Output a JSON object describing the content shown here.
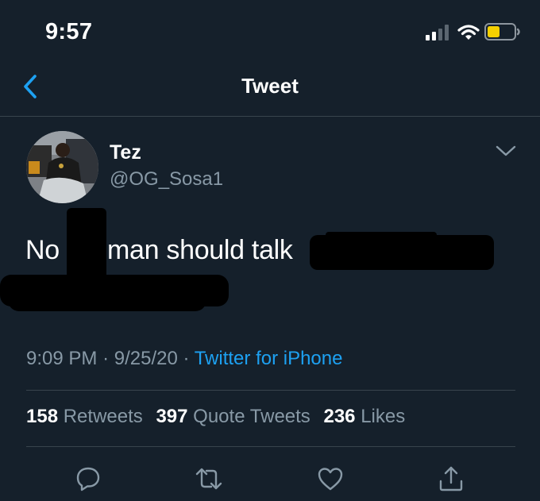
{
  "status_bar": {
    "time": "9:57",
    "icons": [
      "signal-icon",
      "wifi-icon",
      "battery-icon"
    ]
  },
  "nav": {
    "title": "Tweet",
    "back_icon": "chevron-left-icon"
  },
  "tweet": {
    "author_name": "Tez",
    "author_handle": "@OG_Sosa1",
    "text_word_1": "No",
    "text_word_2": "man should talk",
    "time": "9:09 PM",
    "separator": "·",
    "date": "9/25/20",
    "source": "Twitter for iPhone"
  },
  "stats": {
    "retweets_count": "158",
    "retweets_label": "Retweets",
    "quotes_count": "397",
    "quotes_label": "Quote Tweets",
    "likes_count": "236",
    "likes_label": "Likes"
  },
  "actions": [
    "reply-icon",
    "retweet-icon",
    "like-icon",
    "share-icon"
  ],
  "colors": {
    "background": "#15202b",
    "accent": "#1da1f2",
    "secondary_text": "#8899a6",
    "divider": "#38444d",
    "battery": "#f5d000"
  }
}
